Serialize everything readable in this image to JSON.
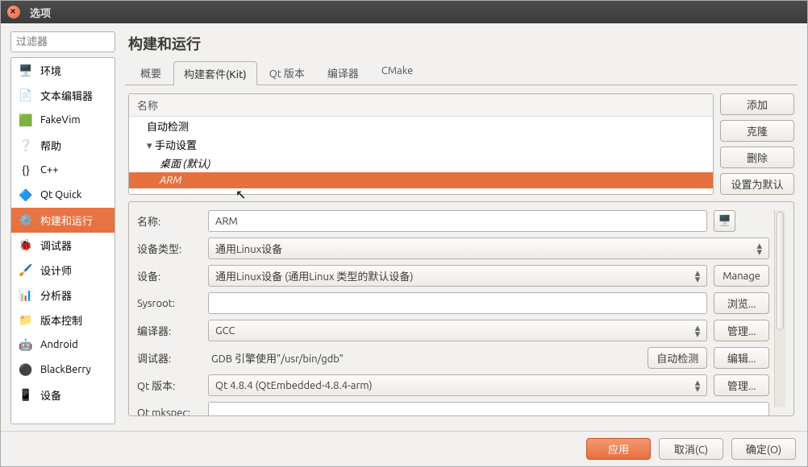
{
  "window": {
    "title": "选项"
  },
  "filter": {
    "placeholder": "过滤器"
  },
  "categories": [
    {
      "key": "env",
      "label": "环境"
    },
    {
      "key": "text",
      "label": "文本编辑器"
    },
    {
      "key": "fakevim",
      "label": "FakeVim"
    },
    {
      "key": "help",
      "label": "帮助"
    },
    {
      "key": "cpp",
      "label": "C++"
    },
    {
      "key": "qtquick",
      "label": "Qt Quick"
    },
    {
      "key": "build",
      "label": "构建和运行",
      "selected": true
    },
    {
      "key": "debugger",
      "label": "调试器"
    },
    {
      "key": "designer",
      "label": "设计师"
    },
    {
      "key": "analyzer",
      "label": "分析器"
    },
    {
      "key": "vcs",
      "label": "版本控制"
    },
    {
      "key": "android",
      "label": "Android"
    },
    {
      "key": "blackberry",
      "label": "BlackBerry"
    },
    {
      "key": "device",
      "label": "设备"
    }
  ],
  "page": {
    "title": "构建和运行"
  },
  "tabs": [
    {
      "key": "overview",
      "label": "概要"
    },
    {
      "key": "kits",
      "label": "构建套件(Kit)",
      "active": true
    },
    {
      "key": "qtver",
      "label": "Qt 版本"
    },
    {
      "key": "compilers",
      "label": "编译器"
    },
    {
      "key": "cmake",
      "label": "CMake"
    }
  ],
  "tree": {
    "header": "名称",
    "auto": "自动检测",
    "manual": "手动设置",
    "manual_children": [
      {
        "label": "桌面 (默认)"
      },
      {
        "label": "ARM",
        "selected": true
      }
    ]
  },
  "kit_buttons": {
    "add": "添加",
    "clone": "克隆",
    "remove": "删除",
    "default": "设置为默认"
  },
  "form": {
    "name_label": "名称:",
    "name_value": "ARM",
    "devtype_label": "设备类型:",
    "devtype_value": "通用Linux设备",
    "device_label": "设备:",
    "device_value": "通用Linux设备 (通用Linux 类型的默认设备)",
    "manage": "Manage",
    "sysroot_label": "Sysroot:",
    "sysroot_value": "",
    "browse": "浏览...",
    "compiler_label": "编译器:",
    "compiler_value": "GCC",
    "manage_cn": "管理...",
    "debugger_label": "调试器:",
    "debugger_value": "GDB 引擎使用\"/usr/bin/gdb\"",
    "autodetect": "自动检测",
    "edit": "编辑...",
    "qtver_label": "Qt 版本:",
    "qtver_value": "Qt 4.8.4 (QtEmbedded-4.8.4-arm)",
    "mkspec_label": "Qt mkspec:",
    "mkspec_value": ""
  },
  "footer": {
    "apply": "应用",
    "cancel": "取消(C)",
    "ok": "确定(O)"
  }
}
